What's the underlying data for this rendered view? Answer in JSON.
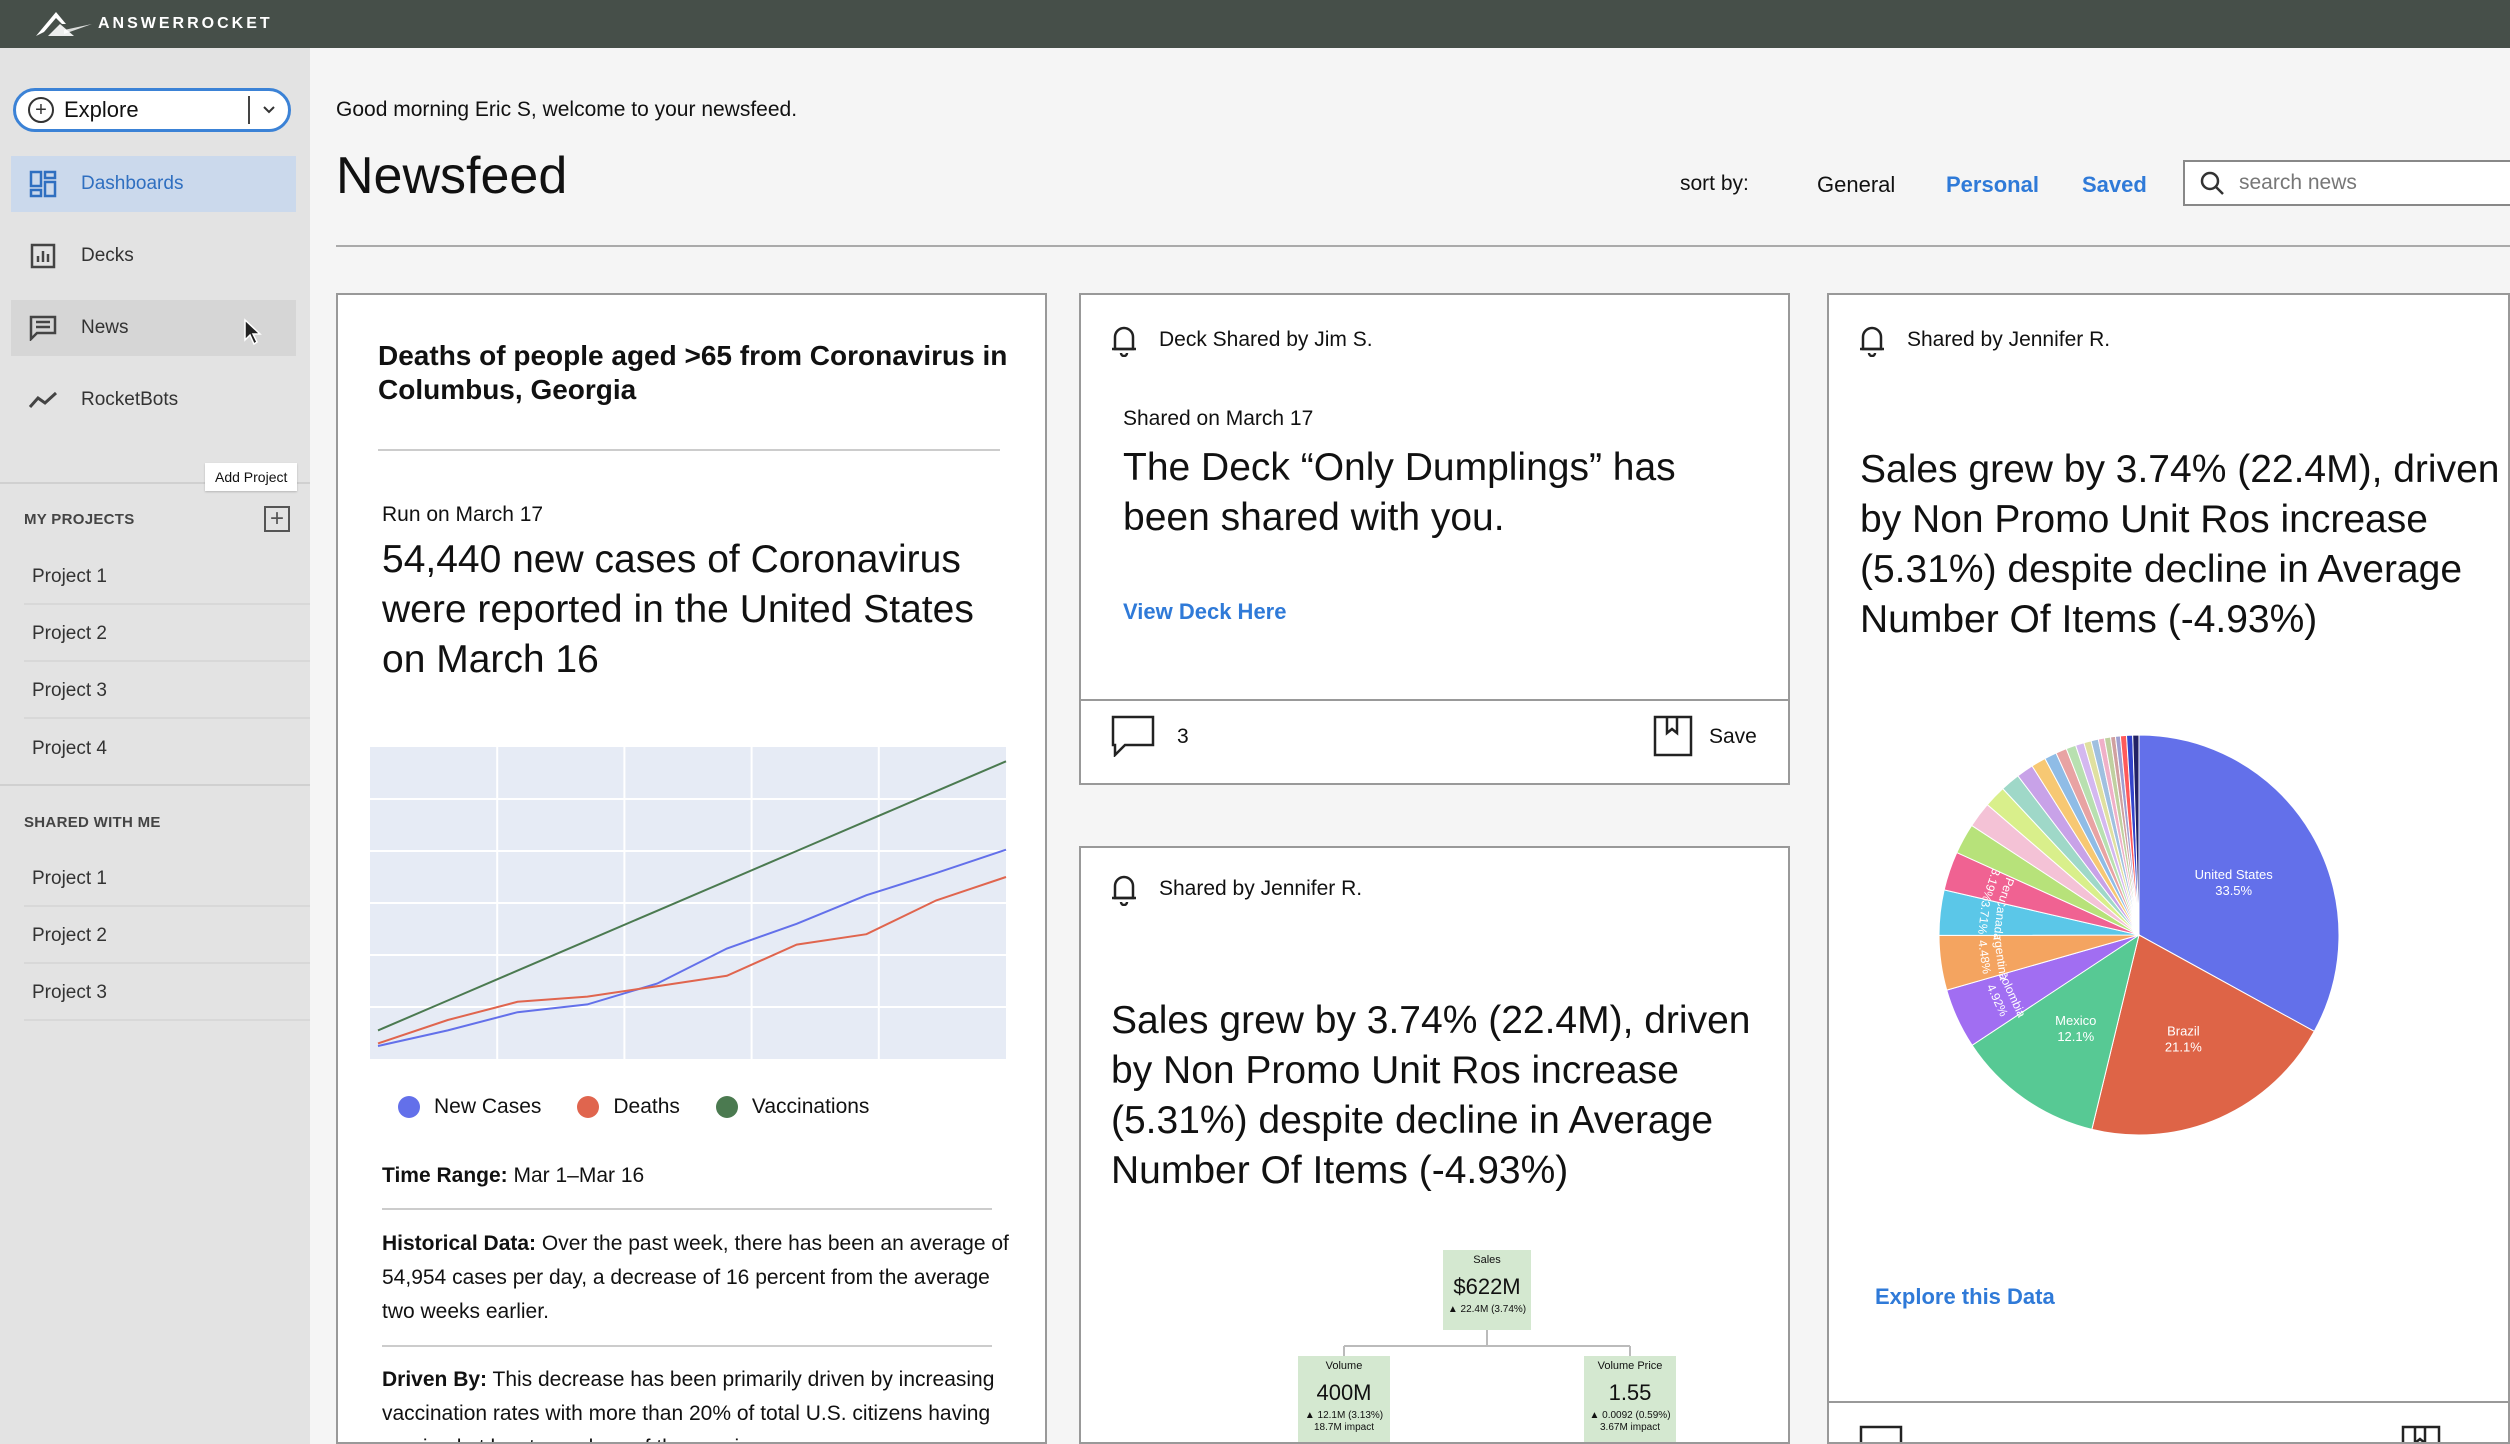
{
  "app": {
    "brand": "ANSWERROCKET"
  },
  "sidebar": {
    "explore_label": "Explore",
    "nav": [
      {
        "label": "Dashboards",
        "icon": "dashboard-icon"
      },
      {
        "label": "Decks",
        "icon": "bar-chart-icon"
      },
      {
        "label": "News",
        "icon": "news-icon"
      },
      {
        "label": "RocketBots",
        "icon": "trend-icon"
      }
    ],
    "tooltip": "Add Project",
    "my_projects_heading": "MY PROJECTS",
    "my_projects": [
      "Project 1",
      "Project 2",
      "Project 3",
      "Project 4"
    ],
    "shared_heading": "SHARED WITH ME",
    "shared_projects": [
      "Project 1",
      "Project 2",
      "Project 3"
    ]
  },
  "header": {
    "greeting": "Good morning Eric S, welcome to your newsfeed.",
    "title": "Newsfeed",
    "sort_label": "sort by:",
    "sort_options": [
      "General",
      "Personal",
      "Saved"
    ],
    "search_placeholder": "search news"
  },
  "colors": {
    "accent": "#2f7ad8",
    "topbar": "#464f49"
  },
  "card1": {
    "title": "Deaths of people aged >65 from Coronavirus in Columbus, Georgia",
    "run_on": "Run on March 17",
    "headline": "54,440 new cases of Coronavirus were reported in the United States on March 16",
    "time_range_label": "Time Range:",
    "time_range_value": " Mar 1–Mar 16",
    "historical_label": "Historical Data:",
    "historical_text": " Over the past week, there has been an average of 54,954 cases per day, a decrease of 16 percent from the average two weeks earlier.",
    "driven_label": "Driven By:",
    "driven_text": " This decrease has been primarily driven by increasing vaccination rates with more than 20% of total U.S. citizens having received at least one dose of the vaccine."
  },
  "chart_data": {
    "type": "line",
    "x": [
      1,
      2,
      3,
      4,
      5,
      6,
      7,
      8,
      9,
      10
    ],
    "series": [
      {
        "name": "New Cases",
        "color": "#6370ea",
        "values": [
          10,
          22,
          36,
          42,
          58,
          85,
          104,
          126,
          143,
          161
        ]
      },
      {
        "name": "Deaths",
        "color": "#e0654e",
        "values": [
          12,
          30,
          44,
          48,
          56,
          64,
          88,
          96,
          122,
          140
        ]
      },
      {
        "name": "Vaccinations",
        "color": "#4b7a50",
        "values": [
          22,
          45,
          68,
          91,
          114,
          137,
          160,
          183,
          206,
          229
        ]
      }
    ],
    "ylim": [
      0,
      240
    ],
    "grid": true
  },
  "card2": {
    "shared_by": "Deck Shared by Jim S.",
    "shared_on": "Shared on March 17",
    "headline": "The Deck “Only Dumplings” has been shared with you.",
    "link": "View Deck Here",
    "comments": "3",
    "save": "Save"
  },
  "card3": {
    "shared_by": "Shared by Jennifer R.",
    "headline": "Sales grew by 3.74% (22.4M), driven by Non Promo Unit Ros increase (5.31%) despite decline in Average Number Of Items (-4.93%)",
    "tree": {
      "root": {
        "label": "Sales",
        "value": "$622M",
        "delta": "▲ 22.4M (3.74%)"
      },
      "left": {
        "label": "Volume",
        "value": "400M",
        "delta": "▲ 12.1M (3.13%)",
        "impact": "18.7M impact"
      },
      "right": {
        "label": "Volume Price",
        "value": "1.55",
        "delta": "▲ 0.0092 (0.59%)",
        "impact": "3.67M impact"
      }
    }
  },
  "card4": {
    "shared_by": "Shared by Jennifer R.",
    "headline": "Sales grew by 3.74% (22.4M), driven by Non Promo Unit Ros increase (5.31%) despite decline in Average Number Of Items (-4.93%)",
    "link": "Explore this Data",
    "pie": [
      {
        "label": "United States",
        "pct": 33.5,
        "color": "#6370ea"
      },
      {
        "label": "Brazil",
        "pct": 21.1,
        "color": "#de6447"
      },
      {
        "label": "Mexico",
        "pct": 12.1,
        "color": "#57c994"
      },
      {
        "label": "Colombia",
        "pct": 4.92,
        "color": "#a16ef2"
      },
      {
        "label": "Argentina",
        "pct": 4.48,
        "color": "#f4a460"
      },
      {
        "label": "Canada",
        "pct": 3.71,
        "color": "#5bc7e8"
      },
      {
        "label": "Peru",
        "pct": 3.19,
        "color": "#f06292"
      },
      {
        "label": "",
        "pct": 2.5,
        "color": "#b7e27a"
      },
      {
        "label": "",
        "pct": 2.1,
        "color": "#f4c2d6"
      },
      {
        "label": "",
        "pct": 1.8,
        "color": "#d9ef8b"
      },
      {
        "label": "",
        "pct": 1.6,
        "color": "#9fd8c8"
      },
      {
        "label": "",
        "pct": 1.4,
        "color": "#c8a2e8"
      },
      {
        "label": "",
        "pct": 1.2,
        "color": "#f7c873"
      },
      {
        "label": "",
        "pct": 1.0,
        "color": "#8fbce6"
      },
      {
        "label": "",
        "pct": 0.9,
        "color": "#e8a3a3"
      },
      {
        "label": "",
        "pct": 0.8,
        "color": "#b8e0b0"
      },
      {
        "label": "",
        "pct": 0.7,
        "color": "#d4b8f0"
      },
      {
        "label": "",
        "pct": 0.6,
        "color": "#e0e0a0"
      },
      {
        "label": "",
        "pct": 0.6,
        "color": "#a0c0e0"
      },
      {
        "label": "",
        "pct": 0.5,
        "color": "#f0b0c8"
      },
      {
        "label": "",
        "pct": 0.5,
        "color": "#c0d0a0"
      },
      {
        "label": "",
        "pct": 0.4,
        "color": "#d0a0a0"
      },
      {
        "label": "",
        "pct": 0.4,
        "color": "#a0a0d0"
      },
      {
        "label": "",
        "pct": 0.5,
        "color": "#ff5a5a"
      },
      {
        "label": "",
        "pct": 0.5,
        "color": "#3344cc"
      },
      {
        "label": "",
        "pct": 0.51,
        "color": "#222266"
      }
    ]
  }
}
